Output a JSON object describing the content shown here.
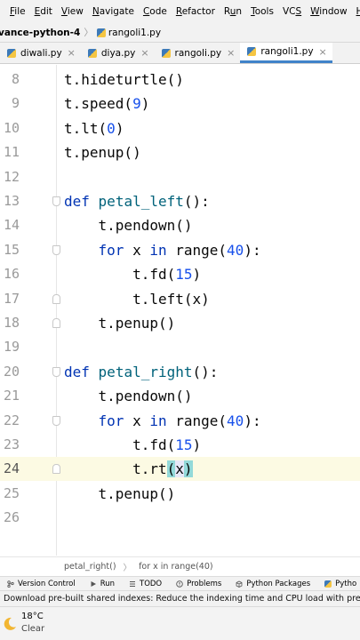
{
  "menu": [
    "File",
    "Edit",
    "View",
    "Navigate",
    "Code",
    "Refactor",
    "Run",
    "Tools",
    "VCS",
    "Window",
    "Help"
  ],
  "menu_underline": [
    "F",
    "E",
    "V",
    "N",
    "C",
    "R",
    "u",
    "T",
    "S",
    "W",
    "H"
  ],
  "nav": {
    "project": "vance-python-4",
    "file": "rangoli1.py"
  },
  "tabs": [
    {
      "label": "diwali.py",
      "active": false
    },
    {
      "label": "diya.py",
      "active": false
    },
    {
      "label": "rangoli.py",
      "active": false
    },
    {
      "label": "rangoli1.py",
      "active": true
    }
  ],
  "editor": {
    "current_line": "24",
    "lines": [
      {
        "no": "8",
        "text": "t.hideturtle()"
      },
      {
        "no": "9",
        "text": "t.speed(9)"
      },
      {
        "no": "10",
        "text": "t.lt(0)"
      },
      {
        "no": "11",
        "text": "t.penup()"
      },
      {
        "no": "12",
        "text": ""
      },
      {
        "no": "13",
        "text": "def petal_left():"
      },
      {
        "no": "14",
        "text": "    t.pendown()"
      },
      {
        "no": "15",
        "text": "    for x in range(40):"
      },
      {
        "no": "16",
        "text": "        t.fd(15)"
      },
      {
        "no": "17",
        "text": "        t.left(x)"
      },
      {
        "no": "18",
        "text": "    t.penup()"
      },
      {
        "no": "19",
        "text": ""
      },
      {
        "no": "20",
        "text": "def petal_right():"
      },
      {
        "no": "21",
        "text": "    t.pendown()"
      },
      {
        "no": "22",
        "text": "    for x in range(40):"
      },
      {
        "no": "23",
        "text": "        t.fd(15)"
      },
      {
        "no": "24",
        "text": "        t.rt(x)"
      },
      {
        "no": "25",
        "text": "    t.penup()"
      },
      {
        "no": "26",
        "text": ""
      }
    ]
  },
  "breadcrumbs": [
    "petal_right()",
    "for x in range(40)"
  ],
  "tool_windows": [
    {
      "label": "Version Control",
      "icon": "version-control-icon"
    },
    {
      "label": "Run",
      "icon": "run-icon"
    },
    {
      "label": "TODO",
      "icon": "todo-icon"
    },
    {
      "label": "Problems",
      "icon": "problems-icon"
    },
    {
      "label": "Python Packages",
      "icon": "packages-icon"
    },
    {
      "label": "Pytho",
      "icon": "python-console-icon"
    }
  ],
  "status_message": "Download pre-built shared indexes: Reduce the indexing time and CPU load with pre-built Pyth",
  "weather": {
    "temp": "18°C",
    "condition": "Clear"
  },
  "colors": {
    "keyword": "#0033b3",
    "function": "#00627a",
    "number": "#1750eb",
    "tab_accent": "#4083c9",
    "brace_match": "#93d9d9"
  }
}
